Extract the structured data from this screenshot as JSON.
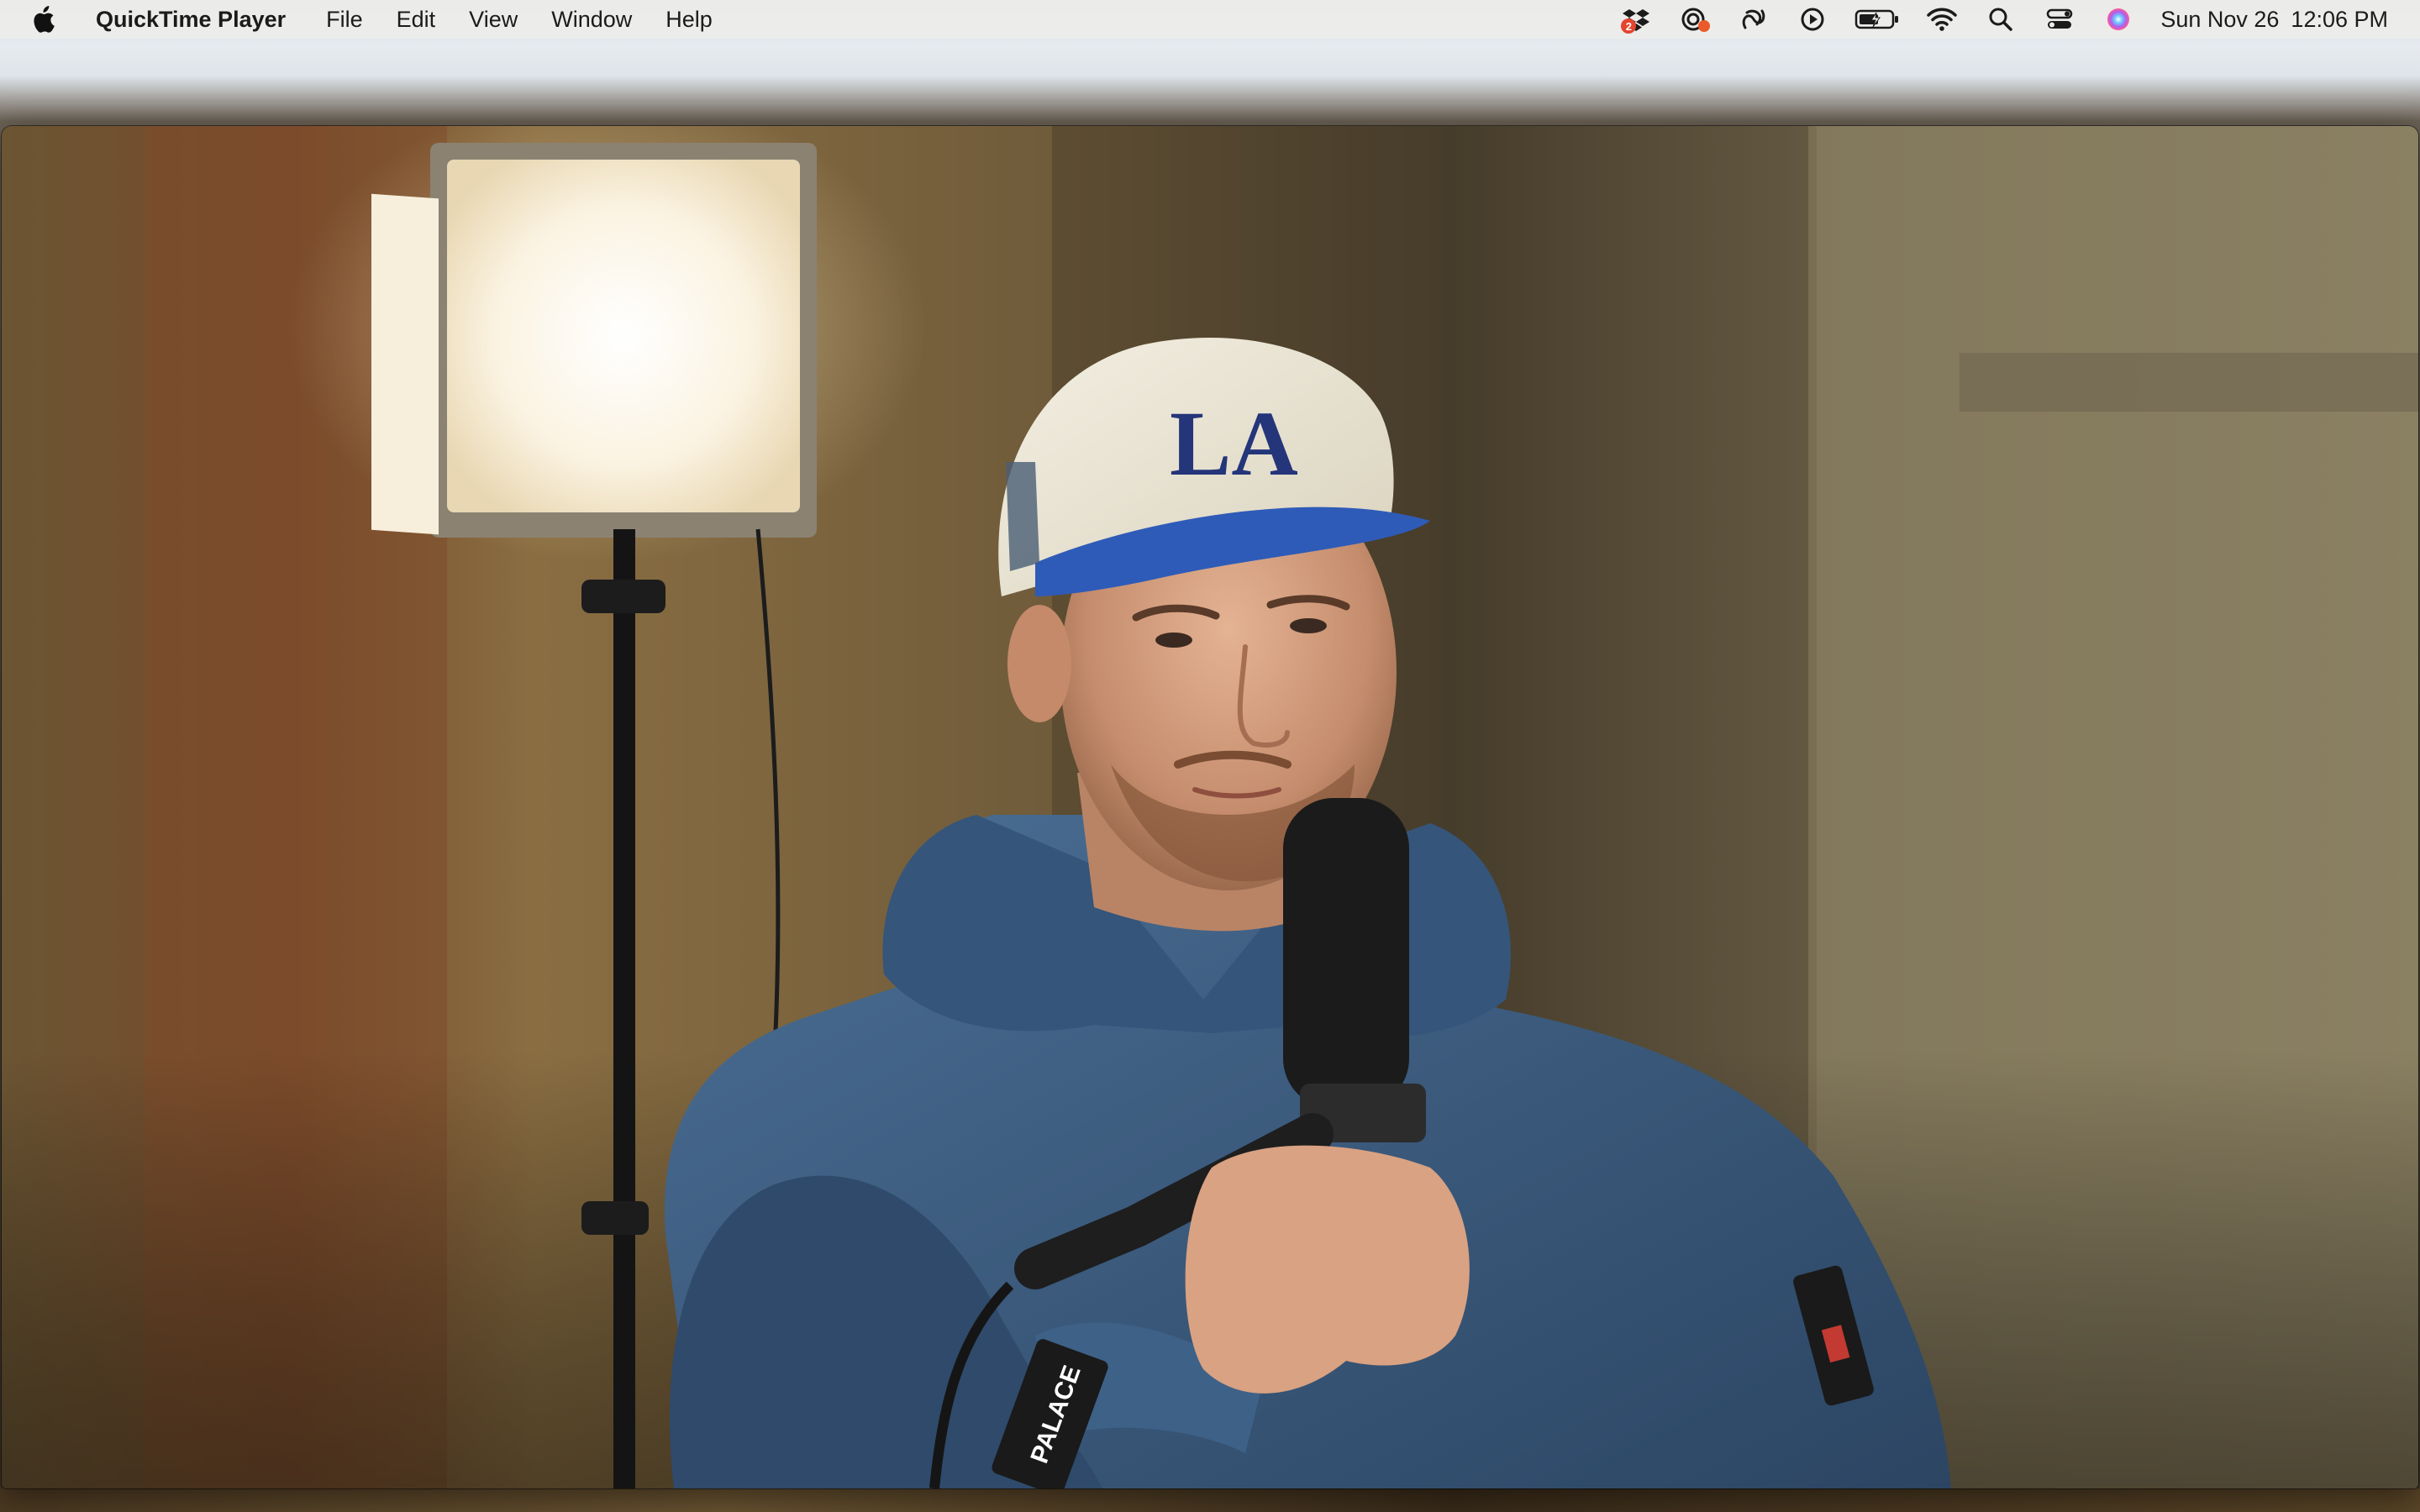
{
  "menubar": {
    "apple_icon": "apple-logo-icon",
    "app_name": "QuickTime Player",
    "items": [
      {
        "label": "File"
      },
      {
        "label": "Edit"
      },
      {
        "label": "View"
      },
      {
        "label": "Window"
      },
      {
        "label": "Help"
      }
    ],
    "status": {
      "dropbox_badge": "2",
      "icons": [
        "dropbox-icon",
        "screen-recorder-icon",
        "adobe-creative-cloud-icon",
        "now-playing-icon",
        "battery-charging-icon",
        "wifi-icon",
        "search-icon",
        "control-center-icon",
        "siri-icon"
      ],
      "date": "Sun Nov 26",
      "time": "12:06 PM"
    }
  },
  "window": {
    "app": "QuickTime Player",
    "content": "video-frame"
  },
  "video": {
    "cap_logo": "LA",
    "sleeve_logo": "PALACE"
  },
  "colors": {
    "menubar_bg": "#ececea",
    "hoodie": "#3c5d80",
    "cap": "#ede8d6",
    "cap_brim": "#2f5bb8"
  }
}
